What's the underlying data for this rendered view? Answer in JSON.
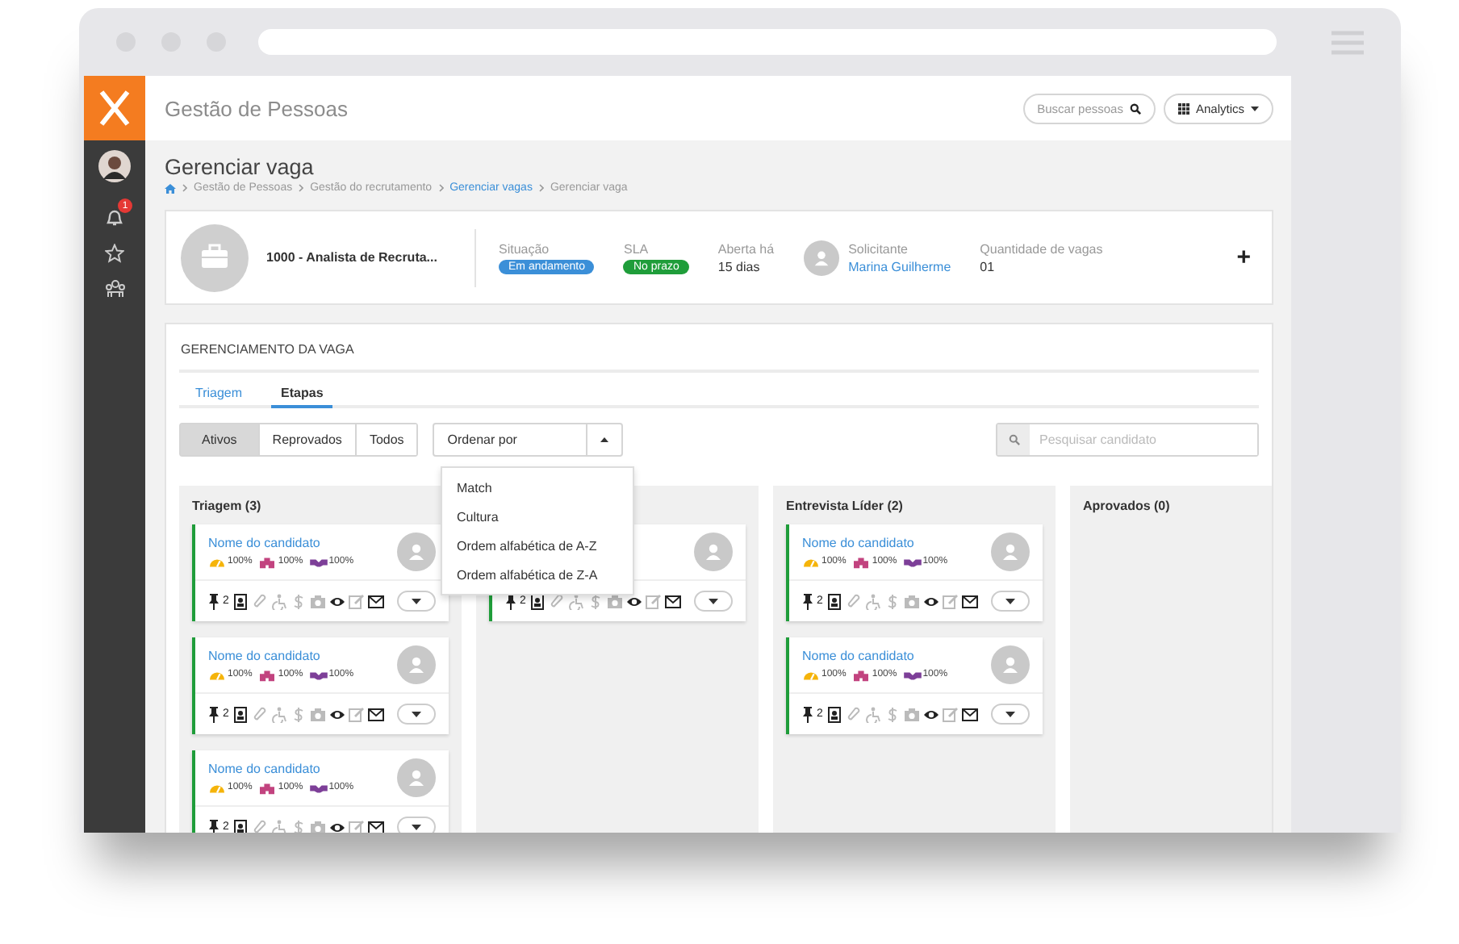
{
  "app": {
    "title": "Gestão de Pessoas",
    "search": {
      "placeholder": "Buscar pessoas"
    },
    "analytics": "Analytics"
  },
  "sidebar": {
    "notifications": "1"
  },
  "page": {
    "title": "Gerenciar vaga",
    "breadcrumb": [
      {
        "label": "Gestão de Pessoas",
        "link": false
      },
      {
        "label": "Gestão do recrutamento",
        "link": false
      },
      {
        "label": "Gerenciar vagas",
        "link": true
      },
      {
        "label": "Gerenciar vaga",
        "link": false
      }
    ]
  },
  "job": {
    "title": "1000 - Analista de Recruta...",
    "status": {
      "label": "Situação",
      "value": "Em andamento"
    },
    "sla": {
      "label": "SLA",
      "value": "No prazo"
    },
    "open": {
      "label": "Aberta há",
      "value": "15 dias"
    },
    "requester": {
      "label": "Solicitante",
      "value": "Marina Guilherme"
    },
    "openings": {
      "label": "Quantidade de vagas",
      "value": "01"
    },
    "add": "+"
  },
  "management": {
    "title": "GERENCIAMENTO DA VAGA",
    "tabs": [
      {
        "label": "Triagem",
        "selected": false
      },
      {
        "label": "Etapas",
        "selected": true
      }
    ],
    "filters": [
      {
        "label": "Ativos",
        "selected": true
      },
      {
        "label": "Reprovados",
        "selected": false
      },
      {
        "label": "Todos",
        "selected": false
      }
    ],
    "sort": {
      "value": "Ordenar por",
      "expanded": true,
      "options": [
        "Match",
        "Cultura",
        "Ordem alfabética de A-Z",
        "Ordem alfabética de Z-A"
      ]
    },
    "search": {
      "placeholder": "Pesquisar candidato"
    },
    "columns": [
      {
        "title": "Triagem (3)",
        "cards": [
          {
            "name": "Nome do candidato",
            "scores": [
              "100%",
              "100%",
              "100%"
            ],
            "pins": "2",
            "tools": [
              true,
              false,
              false,
              false,
              false,
              true,
              false,
              true
            ]
          },
          {
            "name": "Nome do candidato",
            "scores": [
              "100%",
              "100%",
              "100%"
            ],
            "pins": "2",
            "tools": [
              true,
              false,
              false,
              false,
              false,
              true,
              false,
              true
            ]
          },
          {
            "name": "Nome do candidato",
            "scores": [
              "100%",
              "100%",
              "100%"
            ],
            "pins": "2",
            "tools": [
              true,
              false,
              false,
              false,
              false,
              true,
              false,
              true
            ]
          }
        ]
      },
      {
        "cards": [
          {
            "pins": "2",
            "tools": [
              true,
              false,
              false,
              false,
              false,
              true,
              false,
              true
            ]
          }
        ]
      },
      {
        "title": "Entrevista Líder (2)",
        "cards": [
          {
            "name": "Nome do candidato",
            "scores": [
              "100%",
              "100%",
              "100%"
            ],
            "pins": "2",
            "tools": [
              true,
              false,
              false,
              false,
              false,
              true,
              false,
              true
            ]
          },
          {
            "name": "Nome do candidato",
            "scores": [
              "100%",
              "100%",
              "100%"
            ],
            "pins": "2",
            "tools": [
              true,
              false,
              false,
              false,
              false,
              true,
              false,
              true
            ]
          }
        ]
      },
      {
        "title": "Aprovados (0)"
      }
    ]
  }
}
